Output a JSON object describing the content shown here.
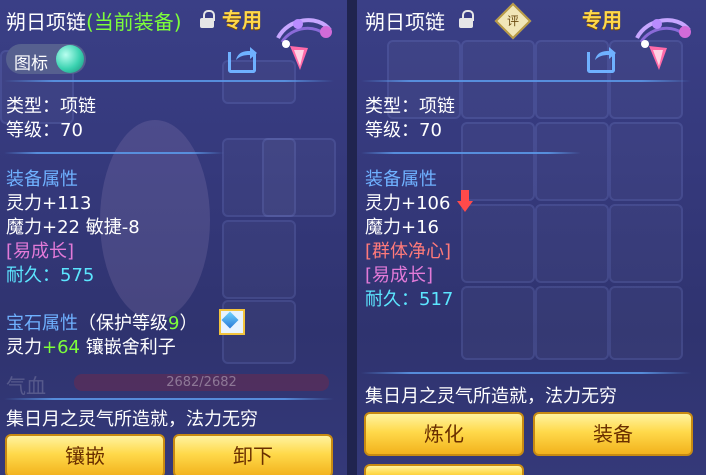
{
  "left_panel": {
    "item_name": "朔日项链",
    "equipped_note": "(当前装备)",
    "special_tag": "专用",
    "icon_toggle_label": "图标",
    "type_line": "类型：项链",
    "level_line": "等级：70",
    "equip_attr_title": "装备属性",
    "attr_1": "灵力+113",
    "attr_2": "魔力+22 敏捷-8",
    "trait": "[易成长]",
    "durability_label": "耐久：",
    "durability_value": "575",
    "gem_title": "宝石属性",
    "gem_protect_prefix": "（保护等级",
    "gem_protect_level": "9",
    "gem_protect_suffix": "）",
    "gem_attr_label": "灵力",
    "gem_attr_value": "+64",
    "gem_inlay": "镶嵌舍利子",
    "hp_label": "气血",
    "hp_value": "2682/2682",
    "description": "集日月之灵气所造就，法力无穷",
    "buttons": {
      "inlay": "镶嵌",
      "unequip": "卸下"
    }
  },
  "right_panel": {
    "item_name": "朔日项链",
    "rate_badge": "评",
    "special_tag": "专用",
    "type_line": "类型：项链",
    "level_line": "等级：70",
    "equip_attr_title": "装备属性",
    "attr_1": "灵力+106",
    "attr_2": "魔力+16",
    "special_effect": "[群体净心]",
    "trait": "[易成长]",
    "durability_label": "耐久：",
    "durability_value": "517",
    "description": "集日月之灵气所造就，法力无穷",
    "buttons": {
      "refine": "炼化",
      "equip": "装备"
    }
  },
  "colors": {
    "section_title": "#6fb1ff",
    "trait": "#e27ad8",
    "durability": "#5ce6ff",
    "equipped": "#7dff3a",
    "special_effect": "#ff7a7a",
    "special_tag": "#ffd84a",
    "button_gold": "#ffd94a"
  },
  "icons": [
    "lock-open-icon",
    "share-icon",
    "necklace-ornament-icon",
    "gem-icon",
    "down-arrow-icon",
    "rate-badge-icon"
  ]
}
